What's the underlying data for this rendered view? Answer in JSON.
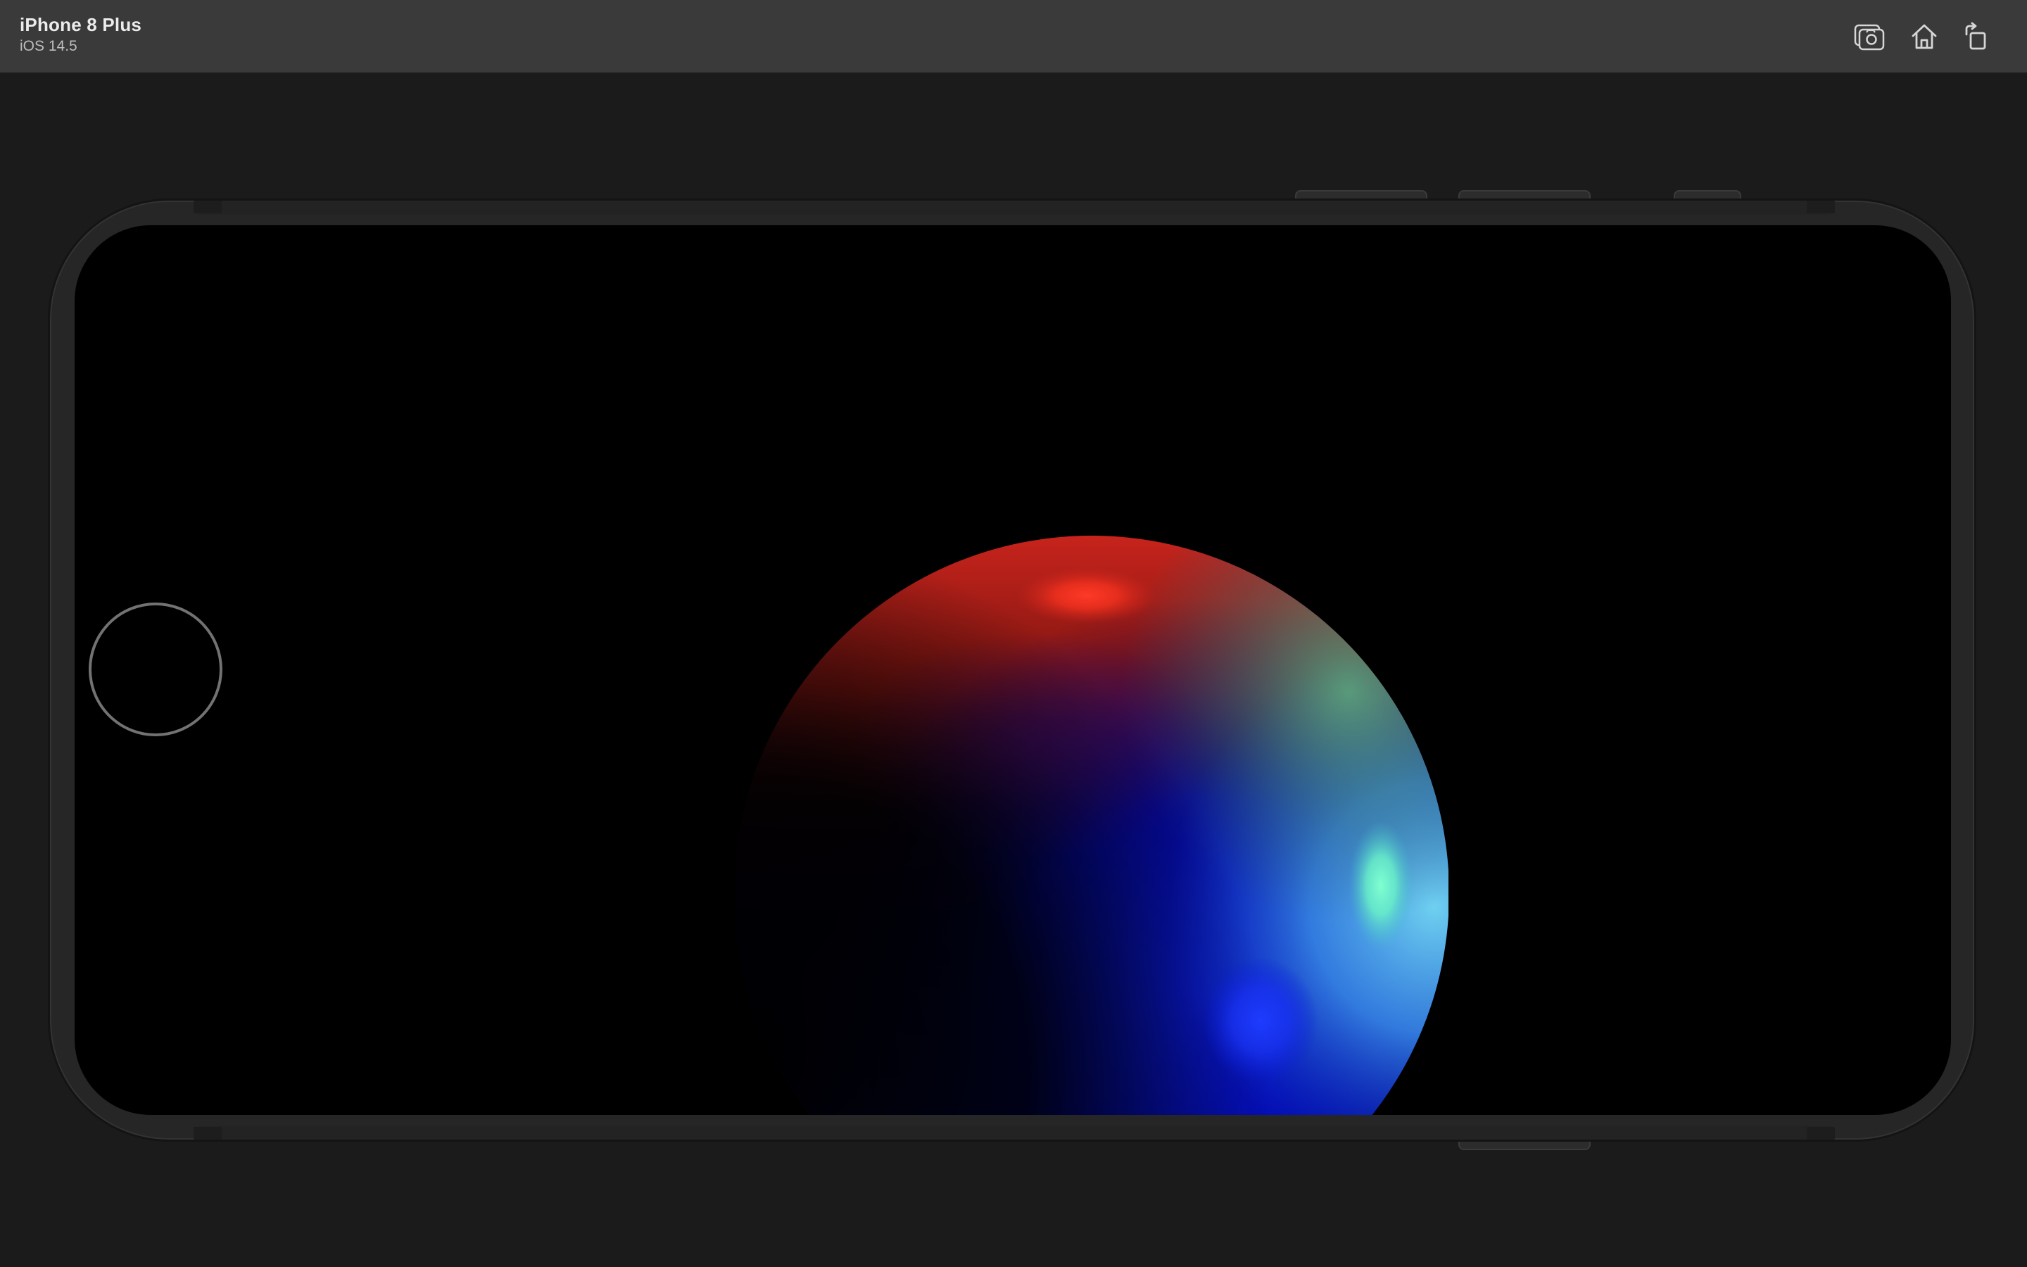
{
  "window": {
    "device_name": "iPhone 8 Plus",
    "os_version": "iOS 14.5"
  },
  "toolbar": {
    "buttons": [
      {
        "name": "screenshot",
        "icon": "camera-icon"
      },
      {
        "name": "home",
        "icon": "home-icon"
      },
      {
        "name": "rotate",
        "icon": "rotate-icon"
      }
    ]
  },
  "device": {
    "orientation": "landscape",
    "frame_color": "#262626",
    "screen_color": "#000000"
  },
  "scene": {
    "object": "sphere",
    "colors": {
      "top": "#e0241a",
      "middle": "#0a14c8",
      "right_rim": "#5ab8f0",
      "highlight_green": "#78f5c8",
      "highlight_blue": "#1a3cff"
    }
  }
}
